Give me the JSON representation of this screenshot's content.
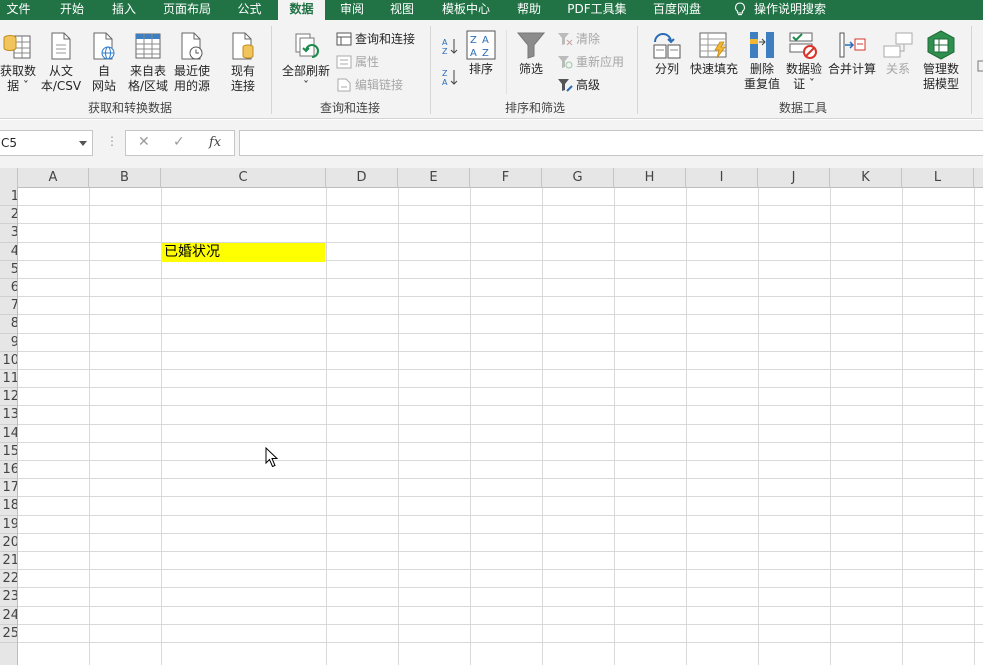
{
  "menu_tabs": [
    {
      "label": "文件",
      "active": false
    },
    {
      "label": "开始",
      "active": false
    },
    {
      "label": "插入",
      "active": false
    },
    {
      "label": "页面布局",
      "active": false
    },
    {
      "label": "公式",
      "active": false
    },
    {
      "label": "数据",
      "active": true
    },
    {
      "label": "审阅",
      "active": false
    },
    {
      "label": "视图",
      "active": false
    },
    {
      "label": "模板中心",
      "active": false
    },
    {
      "label": "帮助",
      "active": false
    },
    {
      "label": "PDF工具集",
      "active": false
    },
    {
      "label": "百度网盘",
      "active": false
    },
    {
      "label": "操作说明搜索",
      "active": false
    }
  ],
  "ribbon": {
    "group_get": {
      "label": "获取和转换数据",
      "get_data": "获取数\n据 ˇ",
      "from_text": "从文\n本/CSV",
      "from_web": "自\n网站",
      "from_table": "来自表\n格/区域",
      "recent": "最近使\n用的源"
    },
    "group_existing": {
      "existing": "现有\n连接"
    },
    "group_query": {
      "label": "查询和连接",
      "refresh_all": "全部刷新",
      "queries": "查询和连接",
      "properties": "属性",
      "edit_links": "编辑链接"
    },
    "group_sort": {
      "label": "排序和筛选",
      "sort": "排序",
      "filter": "筛选",
      "clear": "清除",
      "reapply": "重新应用",
      "advanced": "高级"
    },
    "group_tools": {
      "label": "数据工具",
      "split": "分列",
      "flash_fill": "快速填充",
      "remove_dup": "删除\n重复值",
      "validate": "数据验\n证 ˇ",
      "consolidate": "合并计算",
      "relations": "关系",
      "data_model": "管理数\n据模型"
    }
  },
  "formula_bar": {
    "name_box": "C5",
    "fx": "fx",
    "cancel": "✕",
    "confirm": "✓",
    "formula": ""
  },
  "grid": {
    "columns": [
      "A",
      "B",
      "C",
      "D",
      "E",
      "F",
      "G",
      "H",
      "I",
      "J",
      "K",
      "L"
    ],
    "selected_column": "C",
    "rows": [
      "1",
      "2",
      "3",
      "4",
      "5",
      "6",
      "7",
      "8",
      "9",
      "10",
      "11",
      "12",
      "13",
      "14",
      "15",
      "16",
      "17",
      "18",
      "19",
      "20",
      "21",
      "22",
      "23",
      "24",
      "25"
    ],
    "selected_row": "5",
    "cells": [
      {
        "ref": "C4",
        "value": "已婚状况",
        "fill": "#FFFF00"
      }
    ]
  },
  "colors": {
    "brand": "#217346",
    "highlight": "#FFFF00"
  }
}
